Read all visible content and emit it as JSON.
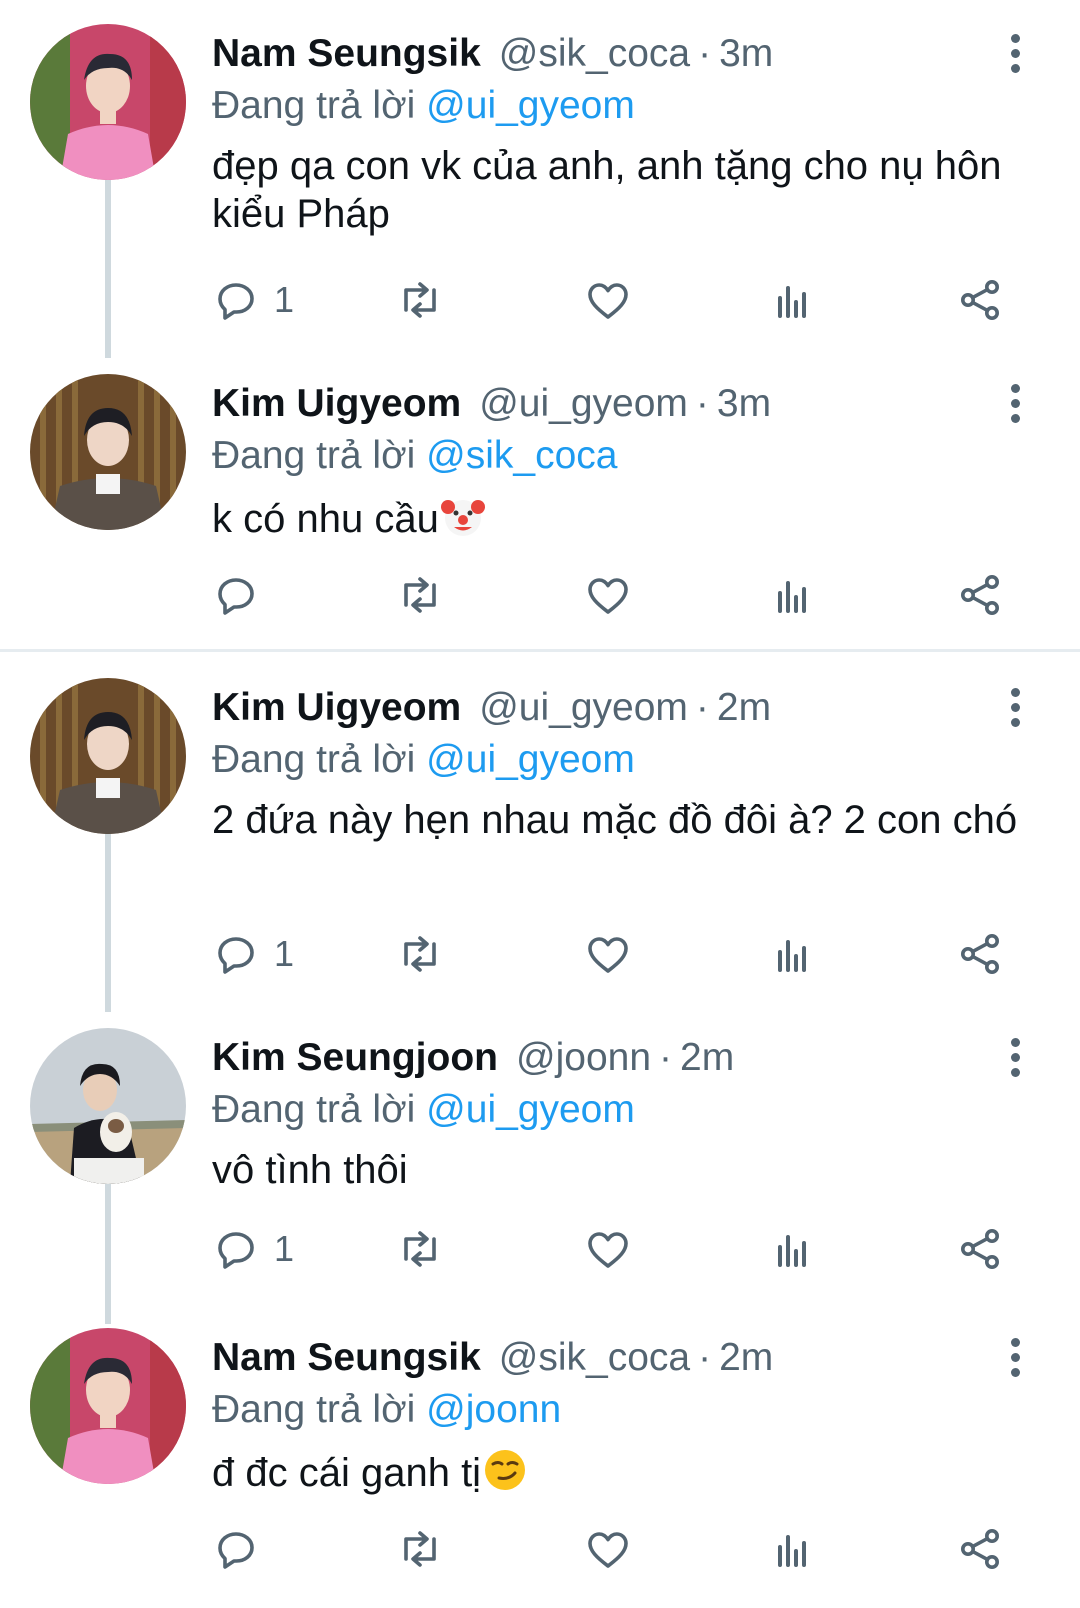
{
  "tweets": [
    {
      "name": "Nam Seungsik",
      "handle": "@sik_coca",
      "time": "3m",
      "replying_prefix": "Đang trả lời",
      "replying_to": "@ui_gyeom",
      "text": "đẹp qa con vk của anh, anh tặng cho nụ hôn kiểu Pháp",
      "reply_count": "1"
    },
    {
      "name": "Kim Uigyeom",
      "handle": "@ui_gyeom",
      "time": "3m",
      "replying_prefix": "Đang trả lời",
      "replying_to": "@sik_coca",
      "text": "k có nhu cầu",
      "emoji": "clown-face",
      "reply_count": ""
    },
    {
      "name": "Kim Uigyeom",
      "handle": "@ui_gyeom",
      "time": "2m",
      "replying_prefix": "Đang trả lời",
      "replying_to": "@ui_gyeom",
      "text": "2 đứa này hẹn nhau mặc đồ đôi à? 2 con chó",
      "reply_count": "1"
    },
    {
      "name": "Kim Seungjoon",
      "handle": "@joonn",
      "time": "2m",
      "replying_prefix": "Đang trả lời",
      "replying_to": "@ui_gyeom",
      "text": "vô tình thôi",
      "reply_count": "1"
    },
    {
      "name": "Nam Seungsik",
      "handle": "@sik_coca",
      "time": "2m",
      "replying_prefix": "Đang trả lời",
      "replying_to": "@joonn",
      "text": "đ đc cái ganh tị",
      "emoji": "smirking-face",
      "reply_count": ""
    }
  ],
  "separator": "·",
  "colors": {
    "text": "#0f1419",
    "secondary": "#536471",
    "accent": "#1d9bf0",
    "thread_line": "#cfd9de"
  },
  "icons": [
    "reply-icon",
    "retweet-icon",
    "like-icon",
    "stats-icon",
    "share-icon",
    "more-icon"
  ]
}
